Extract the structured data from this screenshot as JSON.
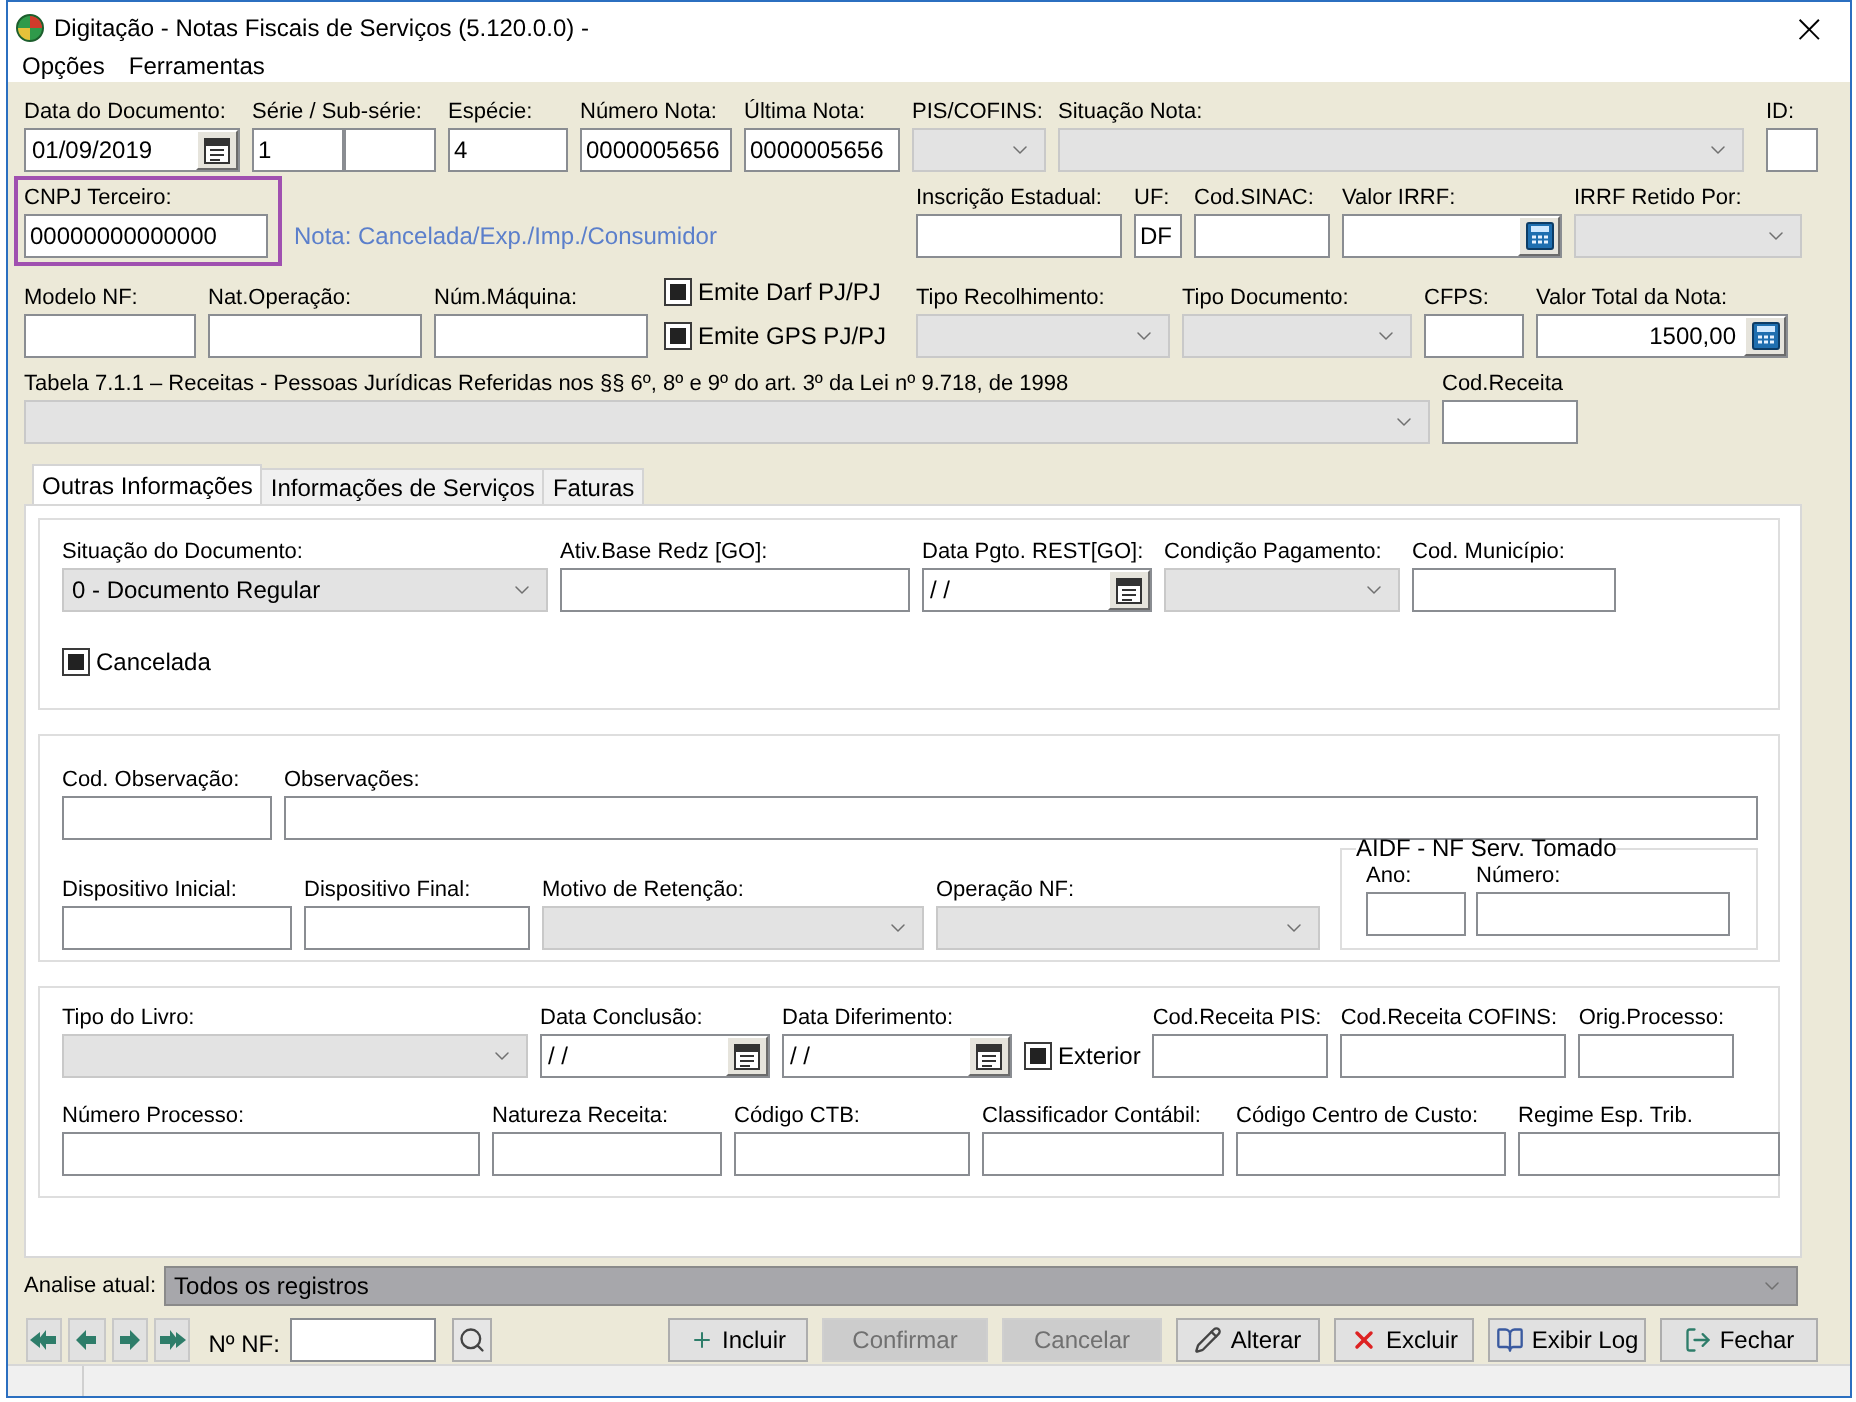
{
  "window": {
    "title": "Digitação - Notas Fiscais de Serviços (5.120.0.0) -",
    "close": "×"
  },
  "menu": [
    "Opções",
    "Ferramentas"
  ],
  "header": {
    "rows": [
      {
        "left": [
          {
            "kind": "date",
            "label": "Data do Documento:",
            "value": "01/09/2019"
          },
          {
            "kind": "pair",
            "label": "Série / Sub-série:",
            "value": "1"
          },
          {
            "kind": "text",
            "label": "Espécie:",
            "value": "4"
          },
          {
            "kind": "text",
            "label": "Número Nota:",
            "value": "0000005656"
          },
          {
            "kind": "text",
            "label": "Última Nota:",
            "value": "0000005656"
          },
          {
            "kind": "combo",
            "label": "PIS/COFINS:"
          },
          {
            "kind": "combo",
            "label": "Situação Nota:"
          }
        ],
        "right": [
          {
            "kind": "text",
            "label": "ID:"
          }
        ]
      },
      {
        "left": [
          {
            "kind": "text",
            "label": "CNPJ Terceiro:",
            "value": "00000000000000",
            "highlighted": true
          },
          {
            "kind": "note",
            "text": "Nota: Cancelada/Exp./Imp./Consumidor"
          }
        ],
        "right": [
          {
            "kind": "text",
            "label": "Inscrição Estadual:"
          },
          {
            "kind": "text",
            "label": "UF:",
            "value": "DF"
          },
          {
            "kind": "text",
            "label": "Cod.SINAC:"
          },
          {
            "kind": "calc",
            "label": "Valor IRRF:"
          },
          {
            "kind": "combo",
            "label": "IRRF Retido Por:"
          }
        ]
      },
      {
        "left": [
          {
            "kind": "text",
            "label": "Modelo NF:"
          },
          {
            "kind": "text",
            "label": "Nat.Operação:"
          },
          {
            "kind": "text",
            "label": "Núm.Máquina:"
          },
          {
            "kind": "checks",
            "items": [
              {
                "label": "Emite Darf PJ/PJ",
                "checked": true
              },
              {
                "label": "Emite GPS PJ/PJ",
                "checked": true
              }
            ]
          }
        ],
        "right": [
          {
            "kind": "combo",
            "label": "Tipo Recolhimento:"
          },
          {
            "kind": "combo",
            "label": "Tipo Documento:"
          },
          {
            "kind": "text",
            "label": "CFPS:"
          },
          {
            "kind": "calc",
            "label": "Valor Total da Nota:",
            "value": "1500,00"
          }
        ]
      },
      {
        "left": [
          {
            "kind": "combo",
            "label": "Tabela 7.1.1 – Receitas - Pessoas Jurídicas Referidas nos §§ 6º, 8º e 9º do art. 3º da Lei nº 9.718, de 1998"
          },
          {
            "kind": "text",
            "label": "Cod.Receita"
          }
        ]
      }
    ]
  },
  "tabs": [
    {
      "label": "Outras Informações",
      "selected": true
    },
    {
      "label": "Informações de Serviços",
      "selected": false
    },
    {
      "label": "Faturas",
      "selected": false
    }
  ],
  "panel": {
    "groups": [
      {
        "rows": [
          [
            {
              "kind": "combo",
              "label": "Situação do Documento:",
              "value": "0 - Documento Regular"
            },
            {
              "kind": "text",
              "label": "Ativ.Base Redz [GO]:"
            },
            {
              "kind": "date",
              "label": "Data Pgto. REST[GO]:",
              "value": "/ /"
            },
            {
              "kind": "combo",
              "label": "Condição Pagamento:"
            },
            {
              "kind": "text",
              "label": "Cod. Município:"
            }
          ],
          [
            {
              "kind": "check",
              "label": "Cancelada",
              "checked": true
            }
          ]
        ]
      },
      {
        "rows": [
          [
            {
              "kind": "text",
              "label": "Cod. Observação:"
            },
            {
              "kind": "text",
              "label": "Observações:"
            }
          ],
          [
            {
              "kind": "text",
              "label": "Dispositivo Inicial:"
            },
            {
              "kind": "text",
              "label": "Dispositivo Final:"
            },
            {
              "kind": "combo",
              "label": "Motivo de Retenção:"
            },
            {
              "kind": "combo",
              "label": "Operação NF:"
            },
            {
              "kind": "fieldset",
              "title": "AIDF - NF Serv. Tomado",
              "fields": [
                {
                  "kind": "text",
                  "label": "Ano:"
                },
                {
                  "kind": "text",
                  "label": "Número:"
                }
              ]
            }
          ]
        ]
      },
      {
        "rows": [
          [
            {
              "kind": "combo",
              "label": "Tipo do Livro:"
            },
            {
              "kind": "date",
              "label": "Data Conclusão:",
              "value": "/ /"
            },
            {
              "kind": "date",
              "label": "Data Diferimento:",
              "value": "/ /"
            },
            {
              "kind": "check",
              "label": "Exterior",
              "checked": true
            },
            {
              "kind": "text",
              "label": "Cod.Receita PIS:"
            },
            {
              "kind": "text",
              "label": "Cod.Receita COFINS:"
            },
            {
              "kind": "text",
              "label": "Orig.Processo:"
            }
          ],
          [
            {
              "kind": "text",
              "label": "Número Processo:"
            },
            {
              "kind": "text",
              "label": "Natureza Receita:"
            },
            {
              "kind": "text",
              "label": "Código CTB:"
            },
            {
              "kind": "text",
              "label": "Classificador Contábil:"
            },
            {
              "kind": "text",
              "label": "Código Centro de Custo:"
            },
            {
              "kind": "text",
              "label": "Regime Esp. Trib."
            }
          ]
        ]
      }
    ]
  },
  "analysis": {
    "label": "Analise atual:",
    "value": "Todos os registros"
  },
  "nf_label": "Nº NF:",
  "actions": [
    {
      "label": "Incluir",
      "disabled": false
    },
    {
      "label": "Confirmar",
      "disabled": true
    },
    {
      "label": "Cancelar",
      "disabled": true
    },
    {
      "label": "Alterar",
      "disabled": false
    },
    {
      "label": "Excluir",
      "disabled": false
    },
    {
      "label": "Exibir Log",
      "disabled": false
    },
    {
      "label": "Fechar",
      "disabled": false
    }
  ]
}
